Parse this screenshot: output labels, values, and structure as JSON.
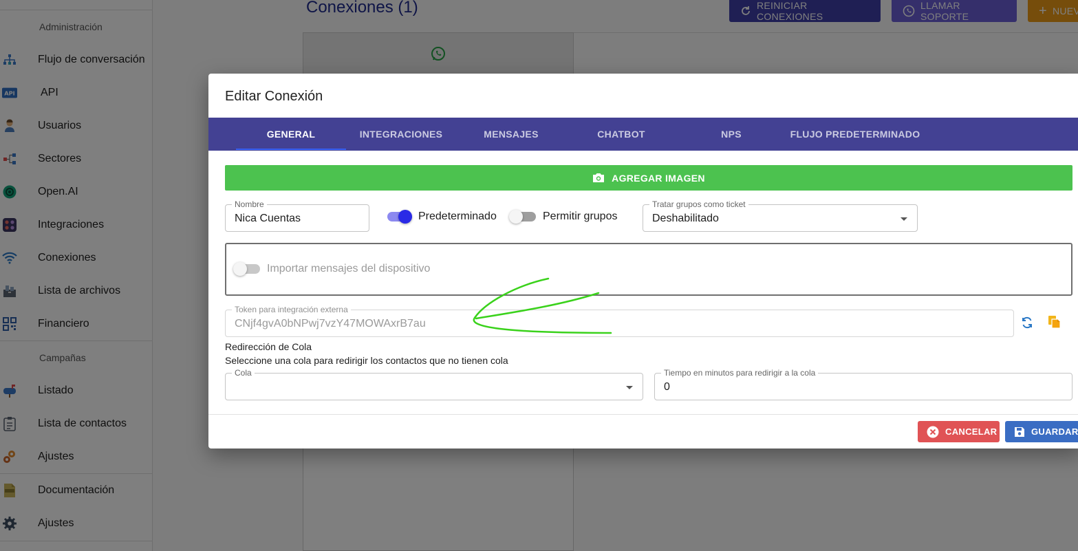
{
  "sidebar": {
    "sections": [
      "Administración",
      "Campañas"
    ],
    "items": [
      {
        "label": "Flujo de conversación",
        "icon": "flow-icon"
      },
      {
        "label": "API",
        "icon": "api-icon"
      },
      {
        "label": "Usuarios",
        "icon": "user-icon"
      },
      {
        "label": "Sectores",
        "icon": "sectors-icon"
      },
      {
        "label": "Open.AI",
        "icon": "openai-icon"
      },
      {
        "label": "Integraciones",
        "icon": "integrations-icon"
      },
      {
        "label": "Conexiones",
        "icon": "wifi-icon"
      },
      {
        "label": "Lista de archivos",
        "icon": "files-icon"
      },
      {
        "label": "Financiero",
        "icon": "qr-icon"
      },
      {
        "label": "Listado",
        "icon": "mailbox-icon"
      },
      {
        "label": "Lista de contactos",
        "icon": "clipboard-icon"
      },
      {
        "label": "Ajustes",
        "icon": "gears-icon"
      },
      {
        "label": "Documentación",
        "icon": "json-file-icon"
      },
      {
        "label": "Ajustes",
        "icon": "gear-icon"
      }
    ]
  },
  "main": {
    "title": "Conexiones (1)",
    "buttons": {
      "restart": "REINICIAR CONEXIONES",
      "support": "LLAMAR SOPORTE",
      "new": "NUEV"
    }
  },
  "dialog": {
    "title": "Editar Conexión",
    "tabs": [
      "GENERAL",
      "INTEGRACIONES",
      "MENSAJES",
      "CHATBOT",
      "NPS",
      "FLUJO PREDETERMINADO"
    ],
    "active_tab": "GENERAL",
    "add_image_label": "AGREGAR IMAGEN",
    "name": {
      "label": "Nombre",
      "value": "Nica Cuentas"
    },
    "default_switch": {
      "label": "Predeterminado",
      "checked": true
    },
    "groups_switch": {
      "label": "Permitir grupos",
      "checked": false
    },
    "groups_ticket": {
      "label": "Tratar grupos como ticket",
      "value": "Deshabilitado"
    },
    "import_switch": {
      "label": "Importar mensajes del dispositivo",
      "checked": false
    },
    "token": {
      "label": "Token para integración externa",
      "value": "CNjf4gvA0bNPwj7vzY47MOWAxrB7au"
    },
    "redirect": {
      "heading": "Redirección de Cola",
      "description": "Seleccione una cola para redirigir los contactos que no tienen cola",
      "queue_label": "Cola",
      "queue_value": "",
      "minutes_label": "Tiempo en minutos para redirigir a la cola",
      "minutes_value": "0"
    },
    "cancel_label": "CANCELAR",
    "save_label": "GUARDAR"
  },
  "colors": {
    "tab_bar": "#434193",
    "accent_blue": "#3a63f5",
    "add_image_green": "#4cc24f",
    "cancel_red": "#e05355",
    "save_blue": "#3a6dc3",
    "annotation_green": "#3ad21b"
  }
}
